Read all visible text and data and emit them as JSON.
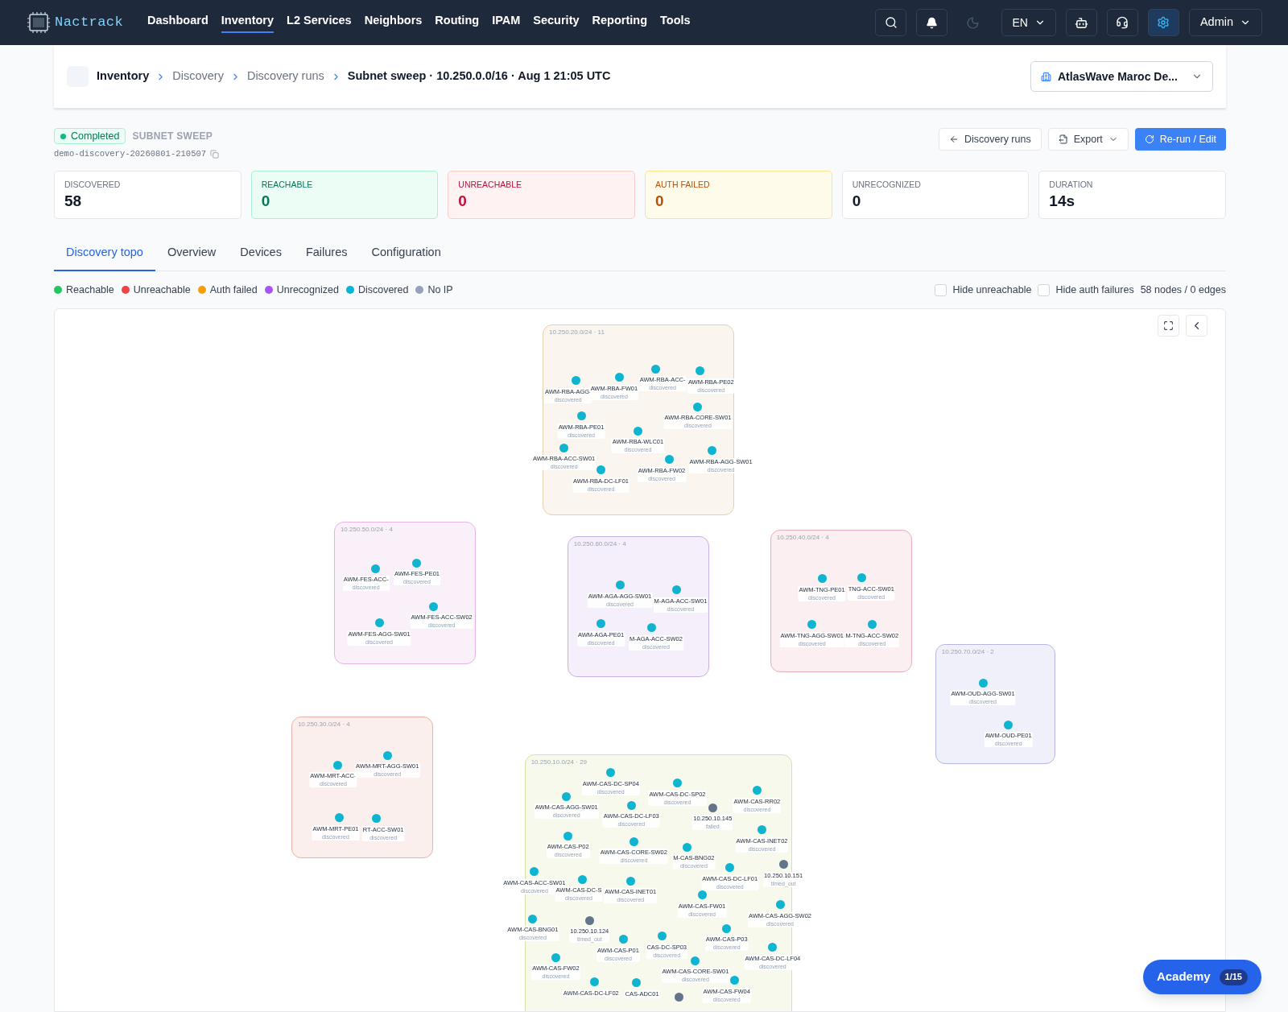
{
  "app": {
    "name": "Nactrack"
  },
  "nav": [
    {
      "label": "Dashboard",
      "selected": false
    },
    {
      "label": "Inventory",
      "selected": true
    },
    {
      "label": "L2 Services",
      "selected": false
    },
    {
      "label": "Neighbors",
      "selected": false
    },
    {
      "label": "Routing",
      "selected": false
    },
    {
      "label": "IPAM",
      "selected": false
    },
    {
      "label": "Security",
      "selected": false
    },
    {
      "label": "Reporting",
      "selected": false
    },
    {
      "label": "Tools",
      "selected": false
    }
  ],
  "header_controls": {
    "language": "EN",
    "user": "Admin"
  },
  "breadcrumb": [
    {
      "label": "Inventory",
      "kind": "root"
    },
    {
      "label": "Discovery",
      "kind": "link"
    },
    {
      "label": "Discovery runs",
      "kind": "link"
    },
    {
      "label": "Subnet sweep · 10.250.0.0/16 · Aug 1 21:05 UTC",
      "kind": "current"
    }
  ],
  "site_selector": "AtlasWave Maroc De...",
  "run": {
    "status": "Completed",
    "type": "SUBNET SWEEP",
    "id": "demo-discovery-20260801-210507"
  },
  "actions": [
    {
      "label": "Discovery runs",
      "kind": "back"
    },
    {
      "label": "Export",
      "kind": "menu"
    },
    {
      "label": "Re-run / Edit",
      "kind": "primary"
    }
  ],
  "stats": [
    {
      "label": "DISCOVERED",
      "value": "58",
      "kind": "neutral"
    },
    {
      "label": "REACHABLE",
      "value": "0",
      "kind": "success"
    },
    {
      "label": "UNREACHABLE",
      "value": "0",
      "kind": "danger"
    },
    {
      "label": "AUTH FAILED",
      "value": "0",
      "kind": "warning"
    },
    {
      "label": "UNRECOGNIZED",
      "value": "0",
      "kind": "neutral"
    },
    {
      "label": "DURATION",
      "value": "14s",
      "kind": "neutral"
    }
  ],
  "tabs": [
    {
      "label": "Discovery topo",
      "selected": true
    },
    {
      "label": "Overview",
      "selected": false
    },
    {
      "label": "Devices",
      "selected": false
    },
    {
      "label": "Failures",
      "selected": false
    },
    {
      "label": "Configuration",
      "selected": false
    }
  ],
  "legend": [
    {
      "label": "Reachable",
      "color": "#22c55e"
    },
    {
      "label": "Unreachable",
      "color": "#ef4444"
    },
    {
      "label": "Auth failed",
      "color": "#f59e0b"
    },
    {
      "label": "Unrecognized",
      "color": "#a855f7"
    },
    {
      "label": "Discovered",
      "color": "#06b6d4"
    },
    {
      "label": "No IP",
      "color": "#94a3b8"
    }
  ],
  "filters": [
    {
      "label": "Hide unreachable",
      "checked": false
    },
    {
      "label": "Hide auth failures",
      "checked": false
    }
  ],
  "graph_counts": "58 nodes / 0 edges",
  "clusters": [
    {
      "label": "10.250.20.0/24 · 11",
      "color": "#e8cfae",
      "nodes": [
        {
          "name": "AWM-RBA-AGG-",
          "status": "discovered",
          "color": "#0fb5d0"
        },
        {
          "name": "AWM-RBA-FW01",
          "status": "discovered",
          "color": "#0fb5d0"
        },
        {
          "name": "AWM-RBA-ACC-",
          "status": "discovered",
          "color": "#0fb5d0"
        },
        {
          "name": "AWM-RBA-PE02",
          "status": "discovered",
          "color": "#0fb5d0"
        },
        {
          "name": "AWM-RBA-CORE-SW01",
          "status": "discovered",
          "color": "#0fb5d0"
        },
        {
          "name": "AWM-RBA-PE01",
          "status": "discovered",
          "color": "#0fb5d0"
        },
        {
          "name": "AWM-RBA-WLC01",
          "status": "discovered",
          "color": "#0fb5d0"
        },
        {
          "name": "AWM-RBA-ACC-SW01",
          "status": "discovered",
          "color": "#0fb5d0"
        },
        {
          "name": "AWM-RBA-DC-LF01",
          "status": "discovered",
          "color": "#0fb5d0"
        },
        {
          "name": "AWM-RBA-FW02",
          "status": "discovered",
          "color": "#0fb5d0"
        },
        {
          "name": "AWM-RBA-AGG-SW01",
          "status": "discovered",
          "color": "#0fb5d0"
        }
      ]
    },
    {
      "label": "10.250.50.0/24 · 4",
      "color": "#e7b3e0",
      "nodes": [
        {
          "name": "AWM-FES-ACC-",
          "status": "discovered",
          "color": "#0fb5d0"
        },
        {
          "name": "AWM-FES-PE01",
          "status": "discovered",
          "color": "#0fb5d0"
        },
        {
          "name": "AWM-FES-ACC-SW02",
          "status": "discovered",
          "color": "#0fb5d0"
        },
        {
          "name": "AWM-FES-AGG-SW01",
          "status": "discovered",
          "color": "#0fb5d0"
        }
      ]
    },
    {
      "label": "10.250.60.0/24 · 4",
      "color": "#c8b0e6",
      "nodes": [
        {
          "name": "AWM-AGA-AGG-SW01",
          "status": "discovered",
          "color": "#0fb5d0"
        },
        {
          "name": "M-AGA-ACC-SW01",
          "status": "discovered",
          "color": "#0fb5d0"
        },
        {
          "name": "AWM-AGA-PE01",
          "status": "discovered",
          "color": "#0fb5d0"
        },
        {
          "name": "M-AGA-ACC-SW02",
          "status": "discovered",
          "color": "#0fb5d0"
        }
      ]
    },
    {
      "label": "10.250.40.0/24 · 4",
      "color": "#eab0ba",
      "nodes": [
        {
          "name": "AWM-TNG-PE01",
          "status": "discovered",
          "color": "#0fb5d0"
        },
        {
          "name": "TNG-ACC-SW01",
          "status": "discovered",
          "color": "#0fb5d0"
        },
        {
          "name": "AWM-TNG-AGG-SW01",
          "status": "discovered",
          "color": "#0fb5d0"
        },
        {
          "name": "M-TNG-ACC-SW02",
          "status": "discovered",
          "color": "#0fb5d0"
        }
      ]
    },
    {
      "label": "10.250.70.0/24 · 2",
      "color": "#b6b6e8",
      "nodes": [
        {
          "name": "AWM-OUD-AGG-SW01",
          "status": "discovered",
          "color": "#0fb5d0"
        },
        {
          "name": "AWM-OUD-PE01",
          "status": "discovered",
          "color": "#0fb5d0"
        }
      ]
    },
    {
      "label": "10.250.30.0/24 · 4",
      "color": "#eab1aa",
      "nodes": [
        {
          "name": "AWM-MRT-ACC-",
          "status": "discovered",
          "color": "#0fb5d0"
        },
        {
          "name": "AWM-MRT-AGG-SW01",
          "status": "discovered",
          "color": "#0fb5d0"
        },
        {
          "name": "AWM-MRT-PE01",
          "status": "discovered",
          "color": "#0fb5d0"
        },
        {
          "name": "RT-ACC-SW01",
          "status": "discovered",
          "color": "#0fb5d0"
        }
      ]
    },
    {
      "label": "10.250.10.0/24 · 29",
      "color": "#d9e2a3",
      "nodes": [
        {
          "name": "AWM-CAS-DC-SP04",
          "status": "discovered",
          "color": "#0fb5d0"
        },
        {
          "name": "AWM-CAS-AGG-SW01",
          "status": "discovered",
          "color": "#0fb5d0"
        },
        {
          "name": "AWM-CAS-DC-SP02",
          "status": "discovered",
          "color": "#0fb5d0"
        },
        {
          "name": "AWM-CAS-RR02",
          "status": "discovered",
          "color": "#0fb5d0"
        },
        {
          "name": "AWM-CAS-DC-LF03",
          "status": "discovered",
          "color": "#0fb5d0"
        },
        {
          "name": "10.250.10.145",
          "status": "failed",
          "color": "#64748b"
        },
        {
          "name": "AWM-CAS-P02",
          "status": "discovered",
          "color": "#0fb5d0"
        },
        {
          "name": "AWM-CAS-CORE-SW02",
          "status": "discovered",
          "color": "#0fb5d0"
        },
        {
          "name": "M-CAS-BNG02",
          "status": "discovered",
          "color": "#0fb5d0"
        },
        {
          "name": "AWM-CAS-INET02",
          "status": "discovered",
          "color": "#0fb5d0"
        },
        {
          "name": "AWM-CAS-ACC-SW01",
          "status": "discovered",
          "color": "#0fb5d0"
        },
        {
          "name": "AWM-CAS-DC-S",
          "status": "discovered",
          "color": "#0fb5d0"
        },
        {
          "name": "AWM-CAS-INET01",
          "status": "discovered",
          "color": "#0fb5d0"
        },
        {
          "name": "AWM-CAS-DC-LF01",
          "status": "discovered",
          "color": "#0fb5d0"
        },
        {
          "name": "10.250.10.151",
          "status": "timed_out",
          "color": "#64748b"
        },
        {
          "name": "AWM-CAS-FW01",
          "status": "discovered",
          "color": "#0fb5d0"
        },
        {
          "name": "AWM-CAS-AGG-SW02",
          "status": "discovered",
          "color": "#0fb5d0"
        },
        {
          "name": "AWM-CAS-BNG01",
          "status": "discovered",
          "color": "#0fb5d0"
        },
        {
          "name": "10.250.10.124",
          "status": "timed_out",
          "color": "#64748b"
        },
        {
          "name": "AWM-CAS-P01",
          "status": "discovered",
          "color": "#0fb5d0"
        },
        {
          "name": "CAS-DC-SP03",
          "status": "discovered",
          "color": "#0fb5d0"
        },
        {
          "name": "AWM-CAS-P03",
          "status": "discovered",
          "color": "#0fb5d0"
        },
        {
          "name": "AWM-CAS-DC-LF04",
          "status": "discovered",
          "color": "#0fb5d0"
        },
        {
          "name": "AWM-CAS-FW02",
          "status": "discovered",
          "color": "#0fb5d0"
        },
        {
          "name": "AWM-CAS-CORE-SW01",
          "status": "discovered",
          "color": "#0fb5d0"
        },
        {
          "name": "AWM-CAS-DC-LF02",
          "color": "#0fb5d0"
        },
        {
          "name": "CAS-ADC01",
          "color": "#0fb5d0"
        },
        {
          "color": "#64748b"
        },
        {
          "name": "AWM-CAS-FW04",
          "status": "discovered",
          "color": "#0fb5d0"
        }
      ]
    }
  ],
  "academy": {
    "label": "Academy",
    "badge": "1/15"
  }
}
